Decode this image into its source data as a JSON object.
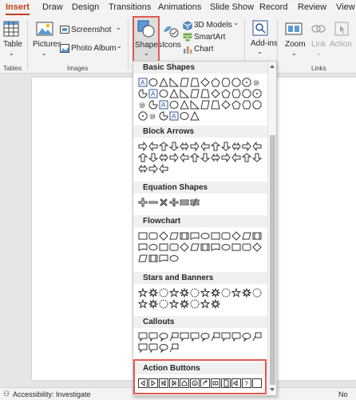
{
  "tabs": [
    "Insert",
    "Draw",
    "Design",
    "Transitions",
    "Animations",
    "Slide Show",
    "Record",
    "Review",
    "View"
  ],
  "ribbon": {
    "table_label": "Table",
    "tables_group": "Tables",
    "pictures_label": "Pictures",
    "screenshot_label": "Screenshot",
    "photo_album_label": "Photo Album",
    "images_group": "Images",
    "shapes_label": "Shapes",
    "icons_label": "Icons",
    "models_3d_label": "3D Models",
    "smartart_label": "SmartArt",
    "chart_label": "Chart",
    "addins_label": "Add-ins",
    "zoom_label": "Zoom",
    "link_label": "Link",
    "action_label": "Action",
    "links_group": "Links"
  },
  "shapes_menu": {
    "categories": [
      {
        "title": "Basic Shapes",
        "count": 42
      },
      {
        "title": "Block Arrows",
        "count": 27
      },
      {
        "title": "Equation Shapes",
        "count": 6
      },
      {
        "title": "Flowchart",
        "count": 28
      },
      {
        "title": "Stars and Banners",
        "count": 20
      },
      {
        "title": "Callouts",
        "count": 16
      },
      {
        "title": "Action Buttons",
        "count": 12
      }
    ]
  },
  "status": {
    "accessibility": "Accessibility: Investigate",
    "notes": "No"
  },
  "colors": {
    "accent": "#c43e1c",
    "highlight": "#e05a4e",
    "shape_stroke": "#333333"
  }
}
